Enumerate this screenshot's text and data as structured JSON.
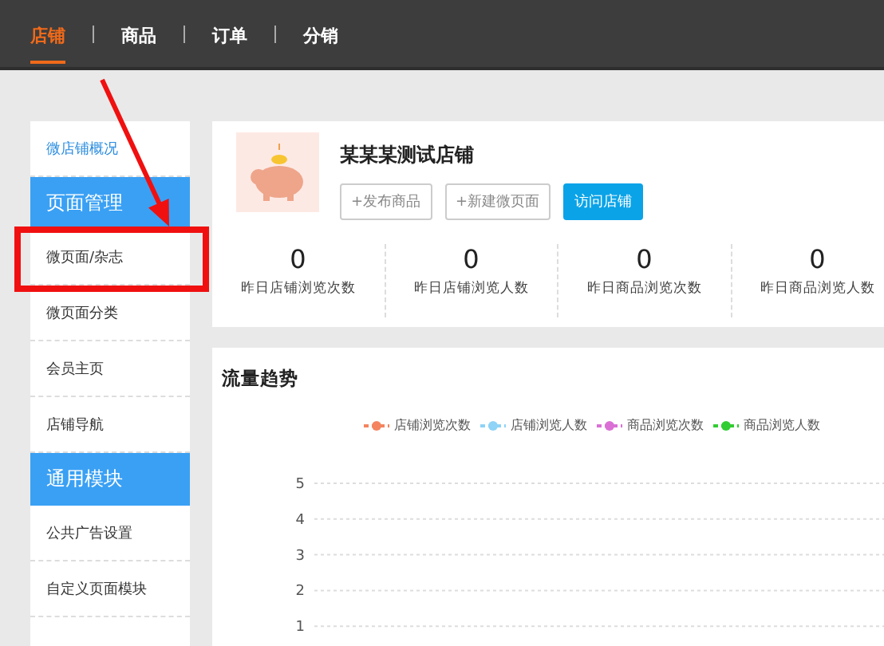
{
  "top_nav": {
    "tabs": [
      {
        "label": "店铺",
        "selected": true
      },
      {
        "label": "商品",
        "selected": false
      },
      {
        "label": "订单",
        "selected": false
      },
      {
        "label": "分销",
        "selected": false
      }
    ]
  },
  "sidebar": {
    "items": [
      {
        "kind": "link",
        "label": "微店铺概况",
        "selected": true
      },
      {
        "kind": "header",
        "label": "页面管理"
      },
      {
        "kind": "link",
        "label": "微页面/杂志",
        "selected": false
      },
      {
        "kind": "link",
        "label": "微页面分类",
        "selected": false
      },
      {
        "kind": "link",
        "label": "会员主页",
        "selected": false
      },
      {
        "kind": "link",
        "label": "店铺导航",
        "selected": false
      },
      {
        "kind": "header",
        "label": "通用模块"
      },
      {
        "kind": "link",
        "label": "公共广告设置",
        "selected": false
      },
      {
        "kind": "link",
        "label": "自定义页面模块",
        "selected": false
      }
    ]
  },
  "store": {
    "name": "某某某测试店铺",
    "buttons": [
      {
        "label": "+发布商品",
        "kind": "outline"
      },
      {
        "label": "+新建微页面",
        "kind": "outline"
      },
      {
        "label": "访问店铺",
        "kind": "primary"
      }
    ]
  },
  "stats": [
    {
      "value": "0",
      "label": "昨日店铺浏览次数"
    },
    {
      "value": "0",
      "label": "昨日店铺浏览人数"
    },
    {
      "value": "0",
      "label": "昨日商品浏览次数"
    },
    {
      "value": "0",
      "label": "昨日商品浏览人数"
    }
  ],
  "traffic": {
    "title": "流量趋势",
    "chart_data": {
      "type": "line",
      "ylim": [
        1,
        5
      ],
      "grid": true,
      "yticks": [
        1,
        2,
        3,
        4,
        5
      ],
      "series": [
        {
          "name": "店铺浏览次数",
          "color": "#f4845f"
        },
        {
          "name": "店铺浏览人数",
          "color": "#8fd3f7"
        },
        {
          "name": "商品浏览次数",
          "color": "#da70d6"
        },
        {
          "name": "商品浏览人数",
          "color": "#32cd32"
        }
      ]
    }
  }
}
